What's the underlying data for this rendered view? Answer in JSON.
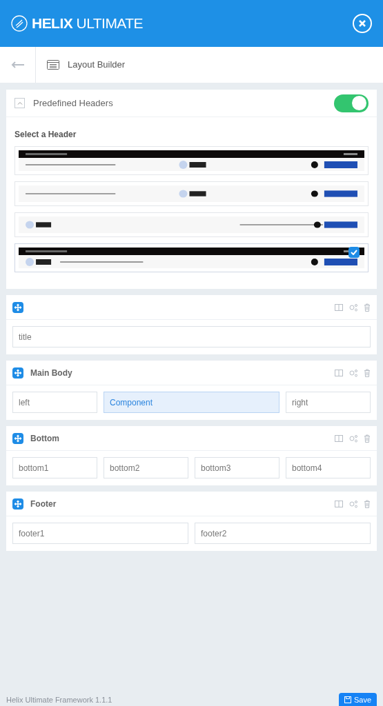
{
  "brand": {
    "strong": "HELIX",
    "light": "ULTIMATE"
  },
  "toolbar": {
    "title": "Layout Builder"
  },
  "predefined": {
    "title": "Predefined Headers",
    "on": true,
    "subtitle": "Select a Header",
    "headers": [
      {
        "kind": "picture",
        "selected": false
      },
      {
        "kind": "picture",
        "selected": false
      },
      {
        "kind": "picture",
        "selected": false
      },
      {
        "kind": "picture",
        "selected": true
      }
    ]
  },
  "sections": [
    {
      "columns": [
        {
          "name": "title",
          "selected": false
        }
      ]
    },
    {
      "title": "Main Body",
      "columns": [
        {
          "name": "left",
          "selected": false
        },
        {
          "name": "Component",
          "selected": true
        },
        {
          "name": "right",
          "selected": false
        }
      ]
    },
    {
      "title": "Bottom",
      "columns": [
        {
          "name": "bottom1",
          "selected": false
        },
        {
          "name": "bottom2",
          "selected": false
        },
        {
          "name": "bottom3",
          "selected": false
        },
        {
          "name": "bottom4",
          "selected": false
        }
      ]
    },
    {
      "title": "Footer",
      "columns": [
        {
          "name": "footer1",
          "selected": false
        },
        {
          "name": "footer2",
          "selected": false
        }
      ]
    }
  ],
  "footer": {
    "version": "Helix Ultimate Framework 1.1.1",
    "save": "Save"
  }
}
